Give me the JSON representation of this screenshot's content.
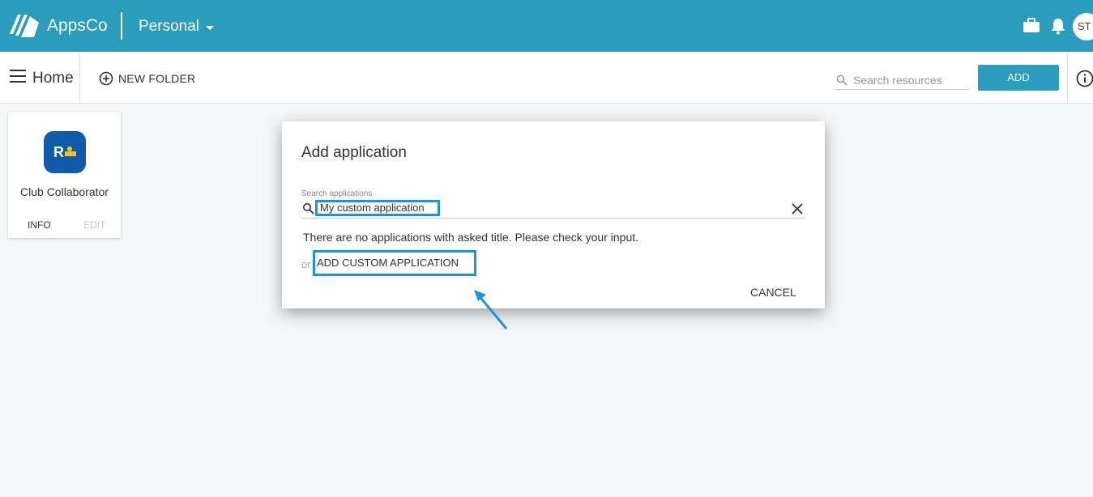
{
  "topbar": {
    "brand": "AppsCo",
    "workspace": "Personal",
    "avatar_initials": "ST",
    "icons": [
      "briefcase-icon",
      "bell-icon"
    ]
  },
  "toolbar": {
    "home_title": "Home",
    "new_folder_label": "NEW FOLDER",
    "search_placeholder": "Search resources",
    "add_label": "ADD"
  },
  "card": {
    "app_name": "Club Collaborator",
    "icon_letter": "R",
    "info_label": "INFO",
    "edit_label": "EDIT"
  },
  "dialog": {
    "title": "Add application",
    "search_label": "Search applications",
    "search_value": "My custom application",
    "no_results": "There are no applications with asked title. Please check your input.",
    "or_text": "or",
    "add_custom_label": "ADD CUSTOM APPLICATION",
    "cancel_label": "CANCEL"
  },
  "colors": {
    "primary": "#2a9dbd",
    "highlight": "#1a95e0",
    "app_icon_bg": "#0f5ba9"
  }
}
